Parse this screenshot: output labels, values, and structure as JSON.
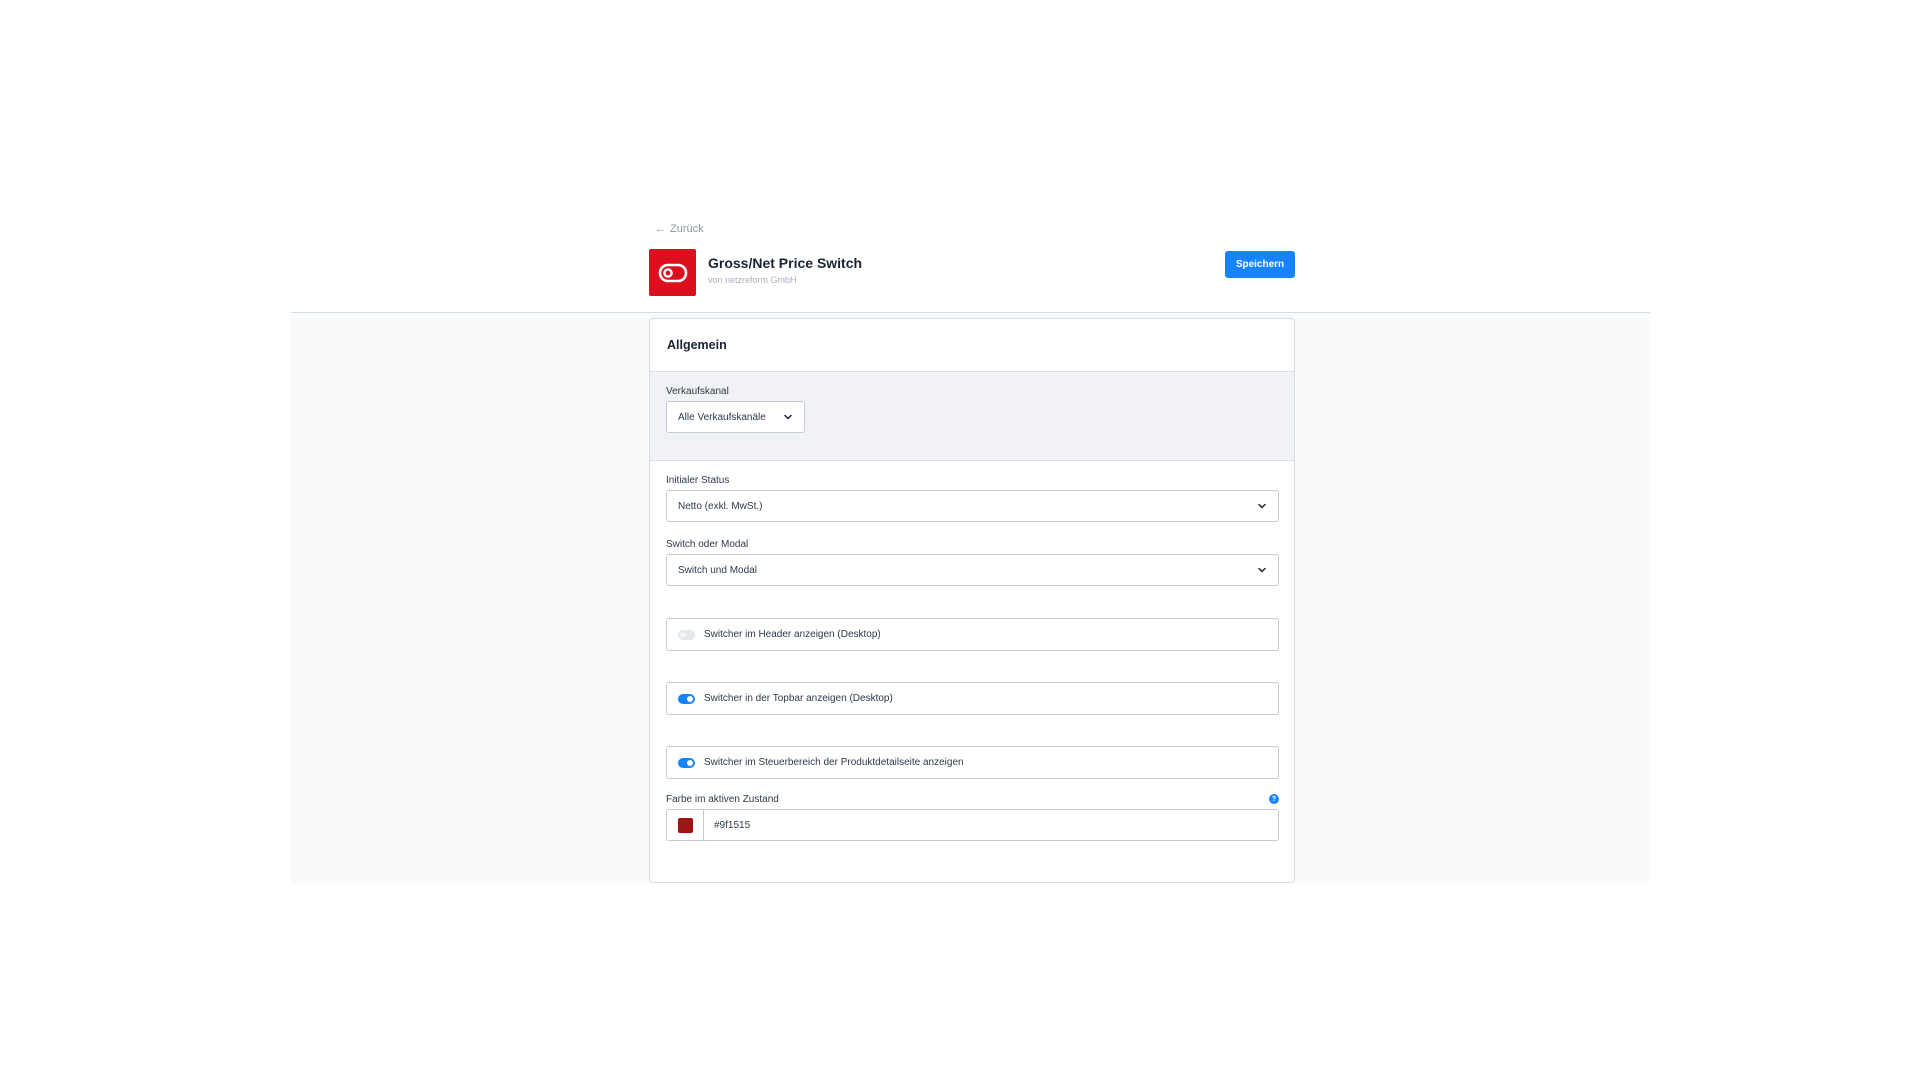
{
  "header": {
    "back_label": "Zurück",
    "app_title": "Gross/Net Price Switch",
    "app_vendor": "von netzreform GmbH",
    "save_label": "Speichern"
  },
  "card": {
    "title": "Allgemein",
    "sales_channel": {
      "label": "Verkaufskanal",
      "value": "Alle Verkaufskanäle"
    },
    "initial_status": {
      "label": "Initialer Status",
      "value": "Netto (exkl. MwSt.)"
    },
    "switch_or_modal": {
      "label": "Switch oder Modal",
      "value": "Switch und Modal"
    },
    "toggles": [
      {
        "label": "Switcher im Header anzeigen (Desktop)",
        "checked": false
      },
      {
        "label": "Switcher in der Topbar anzeigen (Desktop)",
        "checked": true
      },
      {
        "label": "Switcher im Steuerbereich der Produktdetailseite anzeigen",
        "checked": true
      }
    ],
    "active_color": {
      "label": "Farbe im aktiven Zustand",
      "value": "#9f1515",
      "swatch_color": "#9f1515"
    }
  },
  "colors": {
    "primary": "#1883ff",
    "logo_bg": "#dc0f1e"
  },
  "icons": {
    "back": "arrow-left-icon",
    "logo": "toggle-switch-icon",
    "select": "chevron-down-icon",
    "help": "help-circle-icon"
  }
}
